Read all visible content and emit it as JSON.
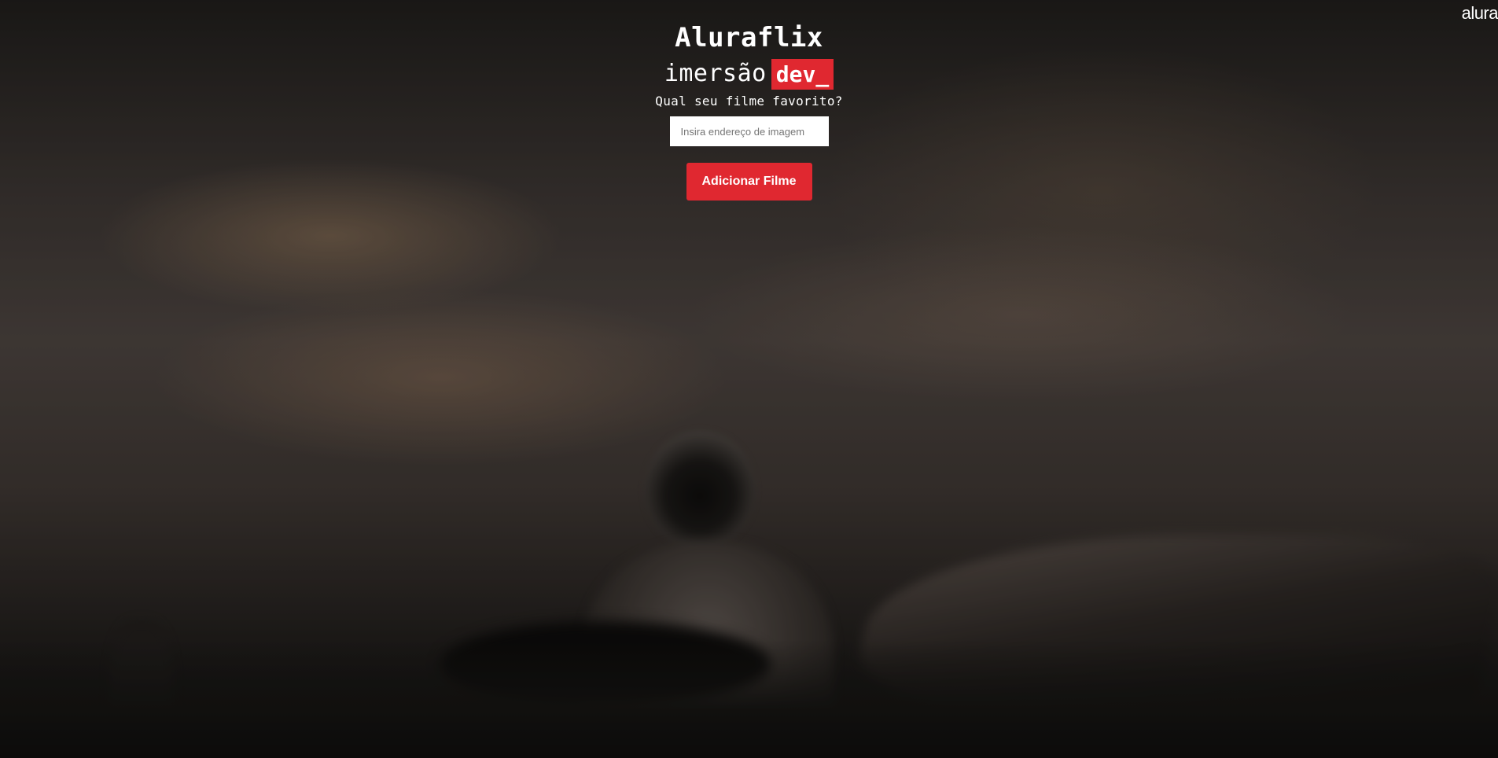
{
  "header": {
    "title": "Aluraflix",
    "subtitle_word": "imersão",
    "subtitle_tag": "dev_",
    "brand": "alura"
  },
  "form": {
    "question": "Qual seu filme favorito?",
    "input_placeholder": "Insira endereço de imagem",
    "input_value": "",
    "add_button_label": "Adicionar Filme"
  },
  "colors": {
    "accent": "#e02830",
    "text": "#ffffff"
  }
}
